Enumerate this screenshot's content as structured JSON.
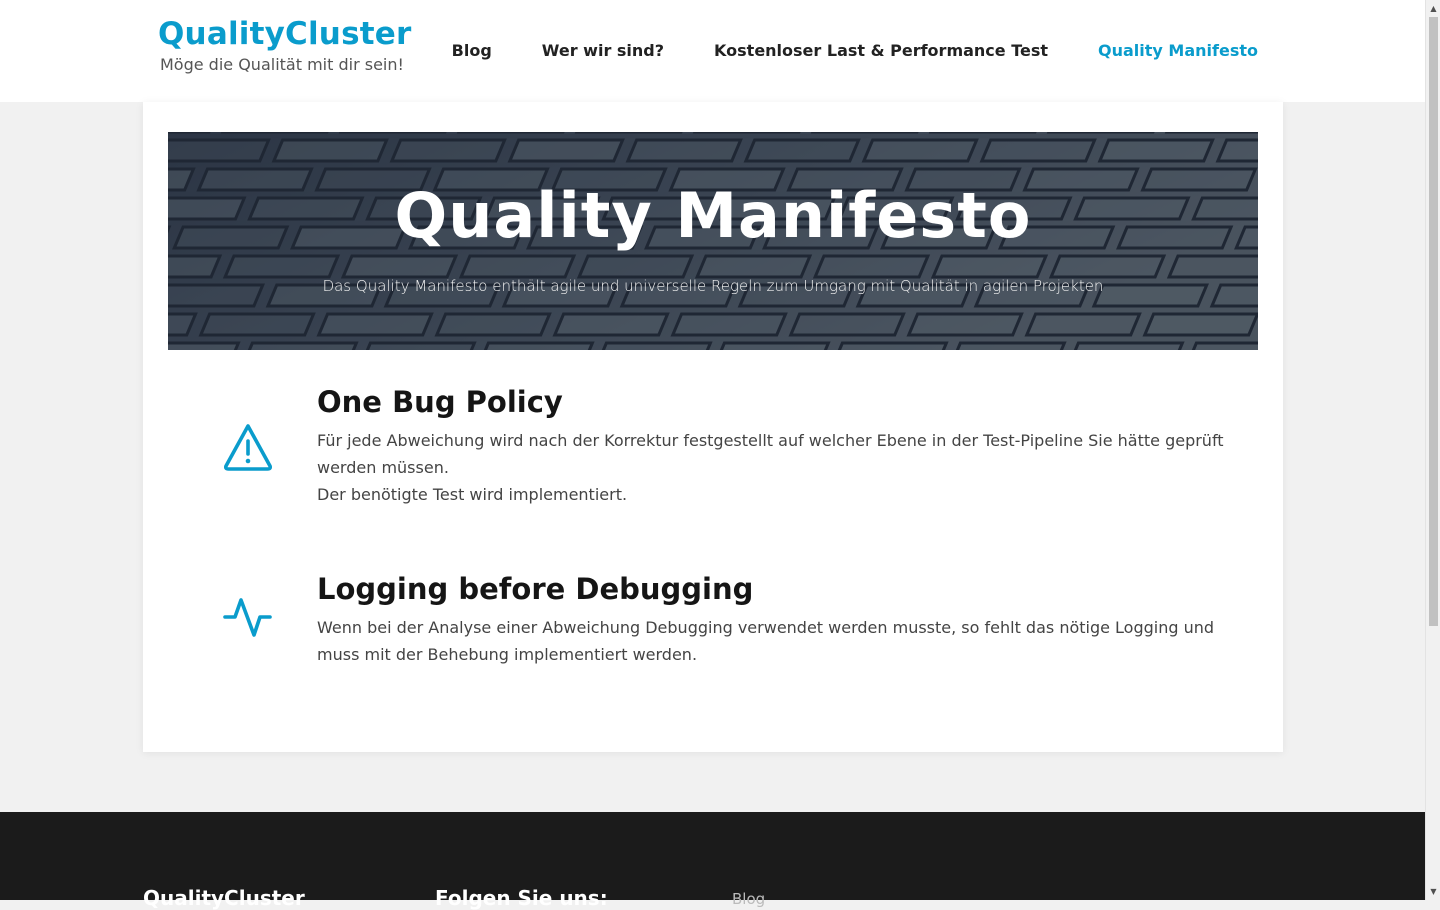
{
  "site": {
    "title": "QualityCluster",
    "tagline": "Möge die Qualität mit dir sein!"
  },
  "nav": {
    "items": [
      {
        "label": "Blog",
        "active": false
      },
      {
        "label": "Wer wir sind?",
        "active": false
      },
      {
        "label": "Kostenloser Last & Performance Test",
        "active": false
      },
      {
        "label": "Quality Manifesto",
        "active": true
      }
    ]
  },
  "hero": {
    "title": "Quality Manifesto",
    "subtitle": "Das Quality Manifesto enthält agile und universelle Regeln zum Umgang mit Qualität in agilen Projekten"
  },
  "features": [
    {
      "icon": "warning-triangle-icon",
      "title": "One Bug Policy",
      "text_line1": "Für jede Abweichung wird nach der Korrektur festgestellt auf welcher Ebene in der Test-Pipeline Sie hätte geprüft werden müssen.",
      "text_line2": "Der benötigte Test wird implementiert."
    },
    {
      "icon": "activity-pulse-icon",
      "title": "Logging before Debugging",
      "text_line1": "Wenn bei der Analyse einer Abweichung Debugging verwendet werden musste, so fehlt das nötige Logging und muss mit der Behebung implementiert werden."
    }
  ],
  "footer": {
    "col1_title": "QualityCluster",
    "col2_title": "Folgen Sie uns:",
    "col3_item": "Blog"
  },
  "colors": {
    "accent": "#0a9ccc",
    "footer_bg": "#1b1b1b"
  }
}
